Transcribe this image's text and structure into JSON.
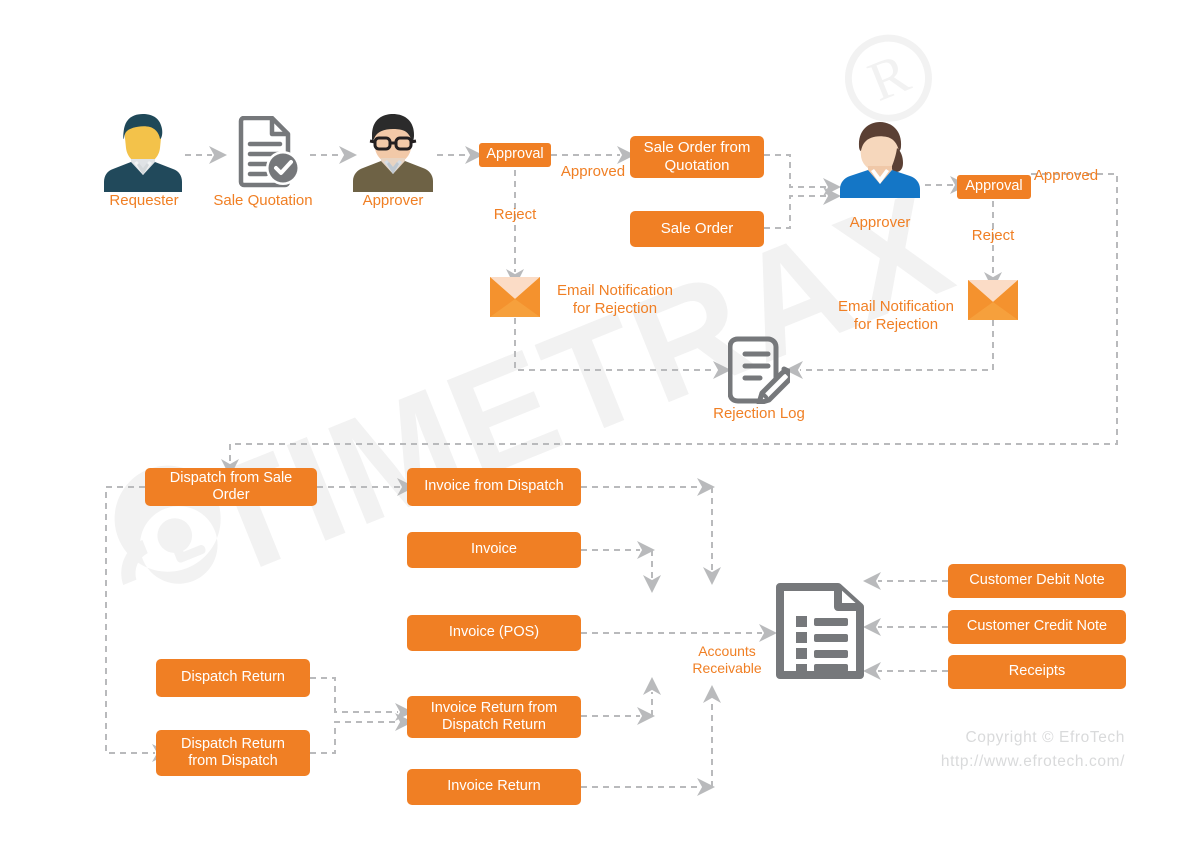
{
  "theme": {
    "orange": "#F07F24",
    "gray_icon": "#76787B",
    "wire": "#b9babc",
    "watermark": "#f2f2f2",
    "copyright_gray": "#d9dadb",
    "envelope_body": "#F6A03C",
    "envelope_flap": "#FAD9C2"
  },
  "actors": {
    "requester": {
      "label": "Requester",
      "icon": "person-avatar-icon"
    },
    "sale_quotation": {
      "label": "Sale Quotation",
      "icon": "document-check-icon"
    },
    "approver_1": {
      "label": "Approver",
      "icon": "person-glasses-avatar-icon"
    },
    "approver_2": {
      "label": "Approver",
      "icon": "person-female-avatar-icon"
    },
    "rejection_log": {
      "label": "Rejection Log",
      "icon": "document-pencil-icon"
    },
    "accounts_receivable": {
      "label": "Accounts\nReceivable",
      "icon": "document-list-icon"
    }
  },
  "decisions": {
    "approval_1": {
      "label": "Approval"
    },
    "approval_2": {
      "label": "Approval"
    }
  },
  "edge_labels": {
    "approved_1": "Approved",
    "reject_1": "Reject",
    "approved_2": "Approved",
    "reject_2": "Reject"
  },
  "notifications": {
    "email_rejection_1": {
      "label": "Email Notification\nfor Rejection",
      "icon": "envelope-icon"
    },
    "email_rejection_2": {
      "label": "Email Notification\nfor Rejection",
      "icon": "envelope-icon"
    }
  },
  "documents": {
    "sale_order_from_quotation": "Sale Order from\nQuotation",
    "sale_order": "Sale Order",
    "dispatch_from_sale_order": "Dispatch from Sale Order",
    "dispatch_return": "Dispatch Return",
    "dispatch_return_from_dispatch": "Dispatch Return\nfrom Dispatch",
    "invoice_from_dispatch": "Invoice from Dispatch",
    "invoice": "Invoice",
    "invoice_pos": "Invoice (POS)",
    "invoice_return_from_dispatch_return": "Invoice Return from\nDispatch Return",
    "invoice_return": "Invoice Return",
    "customer_debit_note": "Customer Debit Note",
    "customer_credit_note": "Customer Credit Note",
    "receipts": "Receipts"
  },
  "watermark": {
    "brand": "TIMETRAX",
    "registered_mark": "®",
    "logo_icon": "clock-logo-icon"
  },
  "footer": {
    "copyright": "Copyright © EfroTech\nhttp://www.efrotech.com/"
  }
}
